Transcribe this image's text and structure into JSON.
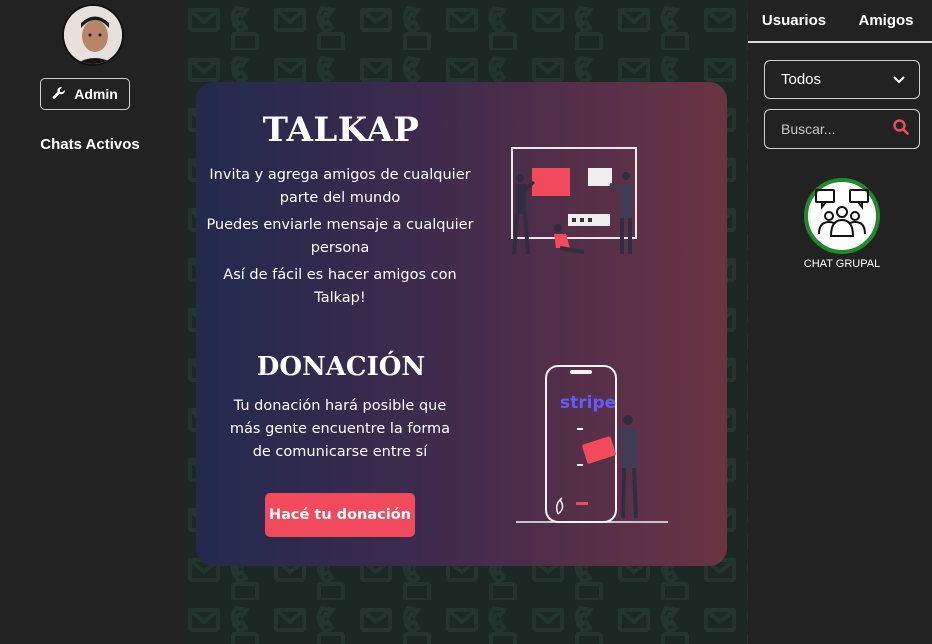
{
  "left_sidebar": {
    "admin_button_label": "Admin",
    "chats_title": "Chats Activos"
  },
  "card": {
    "title": "TALKAP",
    "intro_lines": [
      "Invita y agrega amigos de cualquier parte del mundo",
      "Puedes enviarle mensaje a cualquier persona",
      "Así de fácil es hacer amigos con Talkap!"
    ],
    "donation_title": "DONACIÓN",
    "donation_text": "Tu donación hará posible que más gente encuentre la forma de comunicarse entre sí",
    "donation_button": "Hacé tu donación",
    "stripe_logo_text": "stripe"
  },
  "right_sidebar": {
    "tabs": [
      "Usuarios",
      "Amigos"
    ],
    "filter_selected": "Todos",
    "search_placeholder": "Buscar...",
    "group_chat_label": "CHAT GRUPAL"
  },
  "colors": {
    "accent_red": "#f24a5d",
    "group_ring_green": "#1e8a2a",
    "stripe_purple": "#635bff"
  },
  "icons": [
    "wrench-icon",
    "chevron-down-icon",
    "search-icon",
    "group-chat-icon"
  ]
}
